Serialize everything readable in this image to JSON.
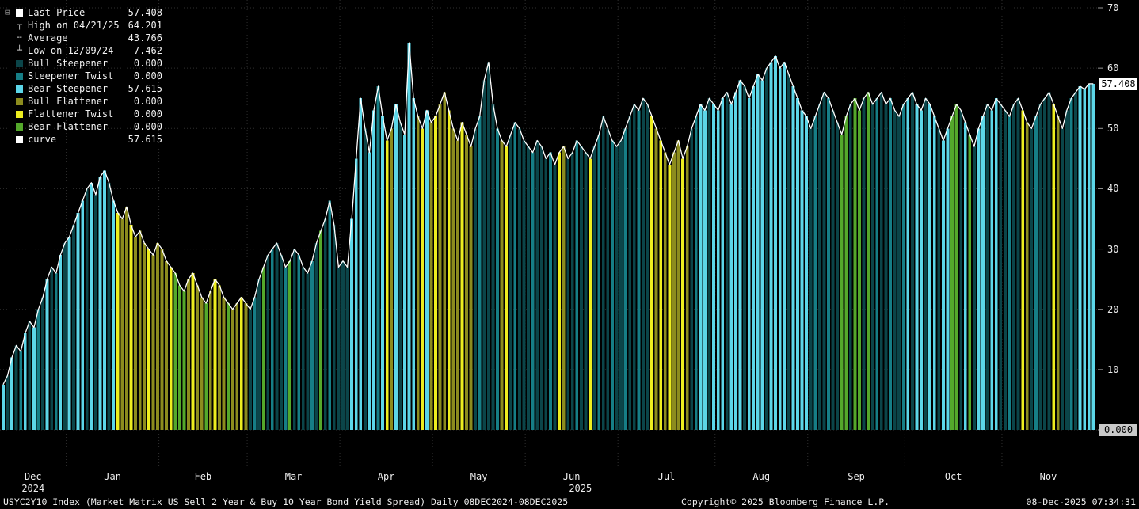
{
  "legend": {
    "collapse_icon": "⊟",
    "items": [
      {
        "label": "Last Price",
        "value": "57.408",
        "swatch": "#ffffff"
      },
      {
        "label": "High on 04/21/25",
        "value": "64.201",
        "glyph": "┬"
      },
      {
        "label": "Average",
        "value": "43.766",
        "glyph": "╌"
      },
      {
        "label": "Low on 12/09/24",
        "value": "7.462",
        "glyph": "┴"
      },
      {
        "label": "Bull Steepener",
        "value": "0.000",
        "swatch": "#0b4549"
      },
      {
        "label": "Steepener Twist",
        "value": "0.000",
        "swatch": "#167e86"
      },
      {
        "label": "Bear Steepener",
        "value": "57.615",
        "swatch": "#5cd6e8"
      },
      {
        "label": "Bull Flattener",
        "value": "0.000",
        "swatch": "#8c8c1e"
      },
      {
        "label": "Flattener Twist",
        "value": "0.000",
        "swatch": "#eded1f"
      },
      {
        "label": "Bear Flattener",
        "value": "0.000",
        "swatch": "#54a82b"
      },
      {
        "label": "curve",
        "value": "57.615",
        "swatch": "#ffffff"
      }
    ]
  },
  "axis": {
    "y_ticks": [
      70,
      60,
      50,
      40,
      30,
      20,
      10,
      0
    ],
    "last_price_label": "57.408",
    "last_price_value": 57.408,
    "zero_label": "0.000",
    "zero_value": 0
  },
  "footer": {
    "left": "USYC2Y10 Index (Market Matrix US Sell 2 Year & Buy 10 Year Bond Yield Spread) Daily 08DEC2024-08DEC2025",
    "copyright": "Copyright© 2025 Bloomberg Finance L.P.",
    "timestamp": "08-Dec-2025 07:34:31"
  },
  "chart_data": {
    "type": "bar",
    "title": "USYC2Y10 Index - US 2s10s Bond Yield Spread",
    "x_range": [
      "08DEC2024",
      "08DEC2025"
    ],
    "ylim": [
      0,
      70
    ],
    "y_gridlines": [
      0,
      10,
      20,
      30,
      40,
      50,
      60,
      70
    ],
    "last_price": 57.408,
    "high": {
      "date": "04/21/25",
      "value": 64.201
    },
    "average": 43.766,
    "low": {
      "date": "12/09/24",
      "value": 7.462
    },
    "line_color": "#ffffff",
    "regime_colors": {
      "BS": "#0b4549",
      "ST": "#167e86",
      "BRS": "#5cd6e8",
      "BF": "#8c8c1e",
      "FT": "#eded1f",
      "BRF": "#54a82b"
    },
    "regime_names": {
      "BS": "Bull Steepener",
      "ST": "Steepener Twist",
      "BRS": "Bear Steepener",
      "BF": "Bull Flattener",
      "FT": "Flattener Twist",
      "BRF": "Bear Flattener"
    },
    "months": [
      {
        "label": "Dec",
        "year": "2024",
        "days": 15
      },
      {
        "label": "Jan",
        "year": "2025",
        "days": 21
      },
      {
        "label": "Feb",
        "year": "2025",
        "days": 20
      },
      {
        "label": "Mar",
        "year": "2025",
        "days": 21
      },
      {
        "label": "Apr",
        "year": "2025",
        "days": 21
      },
      {
        "label": "May",
        "year": "2025",
        "days": 21
      },
      {
        "label": "Jun",
        "year": "2025",
        "days": 21
      },
      {
        "label": "Jul",
        "year": "2025",
        "days": 22
      },
      {
        "label": "Aug",
        "year": "2025",
        "days": 21
      },
      {
        "label": "Sep",
        "year": "2025",
        "days": 22
      },
      {
        "label": "Oct",
        "year": "2025",
        "days": 22
      },
      {
        "label": "Nov",
        "year": "2025",
        "days": 21
      }
    ],
    "values": [
      7.5,
      9,
      12,
      14,
      13,
      16,
      18,
      17,
      20,
      22,
      25,
      27,
      26,
      29,
      31,
      32,
      34,
      36,
      38,
      40,
      41,
      39,
      42,
      43,
      41,
      38,
      36,
      35,
      37,
      34,
      32,
      33,
      31,
      30,
      29,
      31,
      30,
      28,
      27,
      26,
      24,
      23,
      25,
      26,
      24,
      22,
      21,
      23,
      25,
      24,
      22,
      21,
      20,
      21,
      22,
      21,
      20,
      22,
      25,
      27,
      29,
      30,
      31,
      29,
      27,
      28,
      30,
      29,
      27,
      26,
      28,
      31,
      33,
      35,
      38,
      34,
      27,
      28,
      27,
      35,
      45,
      55,
      50,
      46,
      53,
      57,
      52,
      48,
      50,
      54,
      51,
      49,
      64.2,
      55,
      52,
      50,
      53,
      51,
      52,
      54,
      56,
      53,
      50,
      48,
      51,
      49,
      47,
      50,
      52,
      58,
      61,
      54,
      50,
      48,
      47,
      49,
      51,
      50,
      48,
      47,
      46,
      48,
      47,
      45,
      46,
      44,
      46,
      47,
      45,
      46,
      48,
      47,
      46,
      45,
      47,
      49,
      52,
      50,
      48,
      47,
      48,
      50,
      52,
      54,
      53,
      55,
      54,
      52,
      50,
      48,
      46,
      44,
      46,
      48,
      45,
      47,
      50,
      52,
      54,
      53,
      55,
      54,
      53,
      55,
      56,
      54,
      56,
      58,
      57,
      55,
      57,
      59,
      58,
      60,
      61,
      62,
      60,
      61,
      59,
      57,
      55,
      53,
      52,
      50,
      52,
      54,
      56,
      55,
      53,
      51,
      49,
      52,
      54,
      55,
      53,
      55,
      56,
      54,
      55,
      56,
      54,
      55,
      53,
      52,
      54,
      55,
      56,
      54,
      53,
      55,
      54,
      52,
      50,
      48,
      50,
      52,
      54,
      53,
      51,
      49,
      47,
      50,
      52,
      54,
      53,
      55,
      54,
      53,
      52,
      54,
      55,
      53,
      51,
      50,
      52,
      54,
      55,
      56,
      54,
      52,
      50,
      53,
      55,
      56,
      57,
      56.5,
      57.4,
      57.408
    ],
    "regimes": [
      "BRS",
      "BS",
      "BRS",
      "BS",
      "ST",
      "BRS",
      "BS",
      "BRS",
      "ST",
      "BS",
      "BRS",
      "BS",
      "ST",
      "BRS",
      "BS",
      "BRS",
      "BS",
      "BRS",
      "BRS",
      "BS",
      "BRS",
      "BS",
      "BRS",
      "BRS",
      "BS",
      "BRS",
      "FT",
      "BF",
      "BF",
      "FT",
      "BF",
      "BF",
      "BF",
      "FT",
      "BF",
      "BF",
      "BF",
      "BF",
      "FT",
      "BRF",
      "BRF",
      "BRF",
      "BF",
      "FT",
      "BF",
      "BF",
      "BRF",
      "BF",
      "FT",
      "BF",
      "BF",
      "BRF",
      "BF",
      "BF",
      "FT",
      "BF",
      "BS",
      "ST",
      "BS",
      "BRF",
      "BS",
      "ST",
      "BS",
      "BS",
      "ST",
      "BRF",
      "BS",
      "ST",
      "BS",
      "BS",
      "ST",
      "BS",
      "BRF",
      "BS",
      "ST",
      "BS",
      "BS",
      "BS",
      "BS",
      "BRS",
      "BRS",
      "BRS",
      "BS",
      "BRS",
      "BRS",
      "ST",
      "BRS",
      "FT",
      "BF",
      "BRS",
      "BS",
      "BRS",
      "BRS",
      "BRS",
      "BF",
      "FT",
      "BRS",
      "BF",
      "FT",
      "BF",
      "BF",
      "FT",
      "BF",
      "BF",
      "FT",
      "BF",
      "BF",
      "BS",
      "ST",
      "BS",
      "BS",
      "BS",
      "ST",
      "BF",
      "FT",
      "BS",
      "ST",
      "BS",
      "BS",
      "BS",
      "ST",
      "BS",
      "BS",
      "BS",
      "ST",
      "BS",
      "FT",
      "BF",
      "BS",
      "BS",
      "ST",
      "BS",
      "BS",
      "FT",
      "BS",
      "ST",
      "BS",
      "BS",
      "ST",
      "BS",
      "BS",
      "ST",
      "BS",
      "BS",
      "ST",
      "BS",
      "BS",
      "FT",
      "BF",
      "FT",
      "BF",
      "FT",
      "BF",
      "BF",
      "FT",
      "BF",
      "BS",
      "ST",
      "BRS",
      "BRS",
      "BS",
      "BRS",
      "BRS",
      "BRS",
      "BS",
      "BRS",
      "BRS",
      "BRS",
      "BS",
      "BRS",
      "BRS",
      "BRS",
      "BRS",
      "BS",
      "BRS",
      "BRS",
      "BRS",
      "BRS",
      "BS",
      "BRS",
      "BRS",
      "BRS",
      "BRS",
      "BS",
      "ST",
      "BS",
      "BS",
      "ST",
      "BS",
      "BS",
      "BRF",
      "BRF",
      "BS",
      "BRF",
      "BRF",
      "BS",
      "BRF",
      "BS",
      "ST",
      "BS",
      "BS",
      "ST",
      "BS",
      "BS",
      "ST",
      "BRS",
      "BS",
      "BRS",
      "BRS",
      "BS",
      "BRS",
      "BRS",
      "BS",
      "BRS",
      "BRS",
      "BRF",
      "BRF",
      "BS",
      "BRS",
      "BRF",
      "BS",
      "BRS",
      "BRS",
      "BS",
      "BRS",
      "BRS",
      "BS",
      "BS",
      "ST",
      "BS",
      "BS",
      "FT",
      "BF",
      "BS",
      "ST",
      "BS",
      "BS",
      "BS",
      "FT",
      "BF",
      "BS",
      "BS",
      "ST",
      "BS",
      "BRS",
      "BRS",
      "BRS",
      "BRS"
    ]
  }
}
